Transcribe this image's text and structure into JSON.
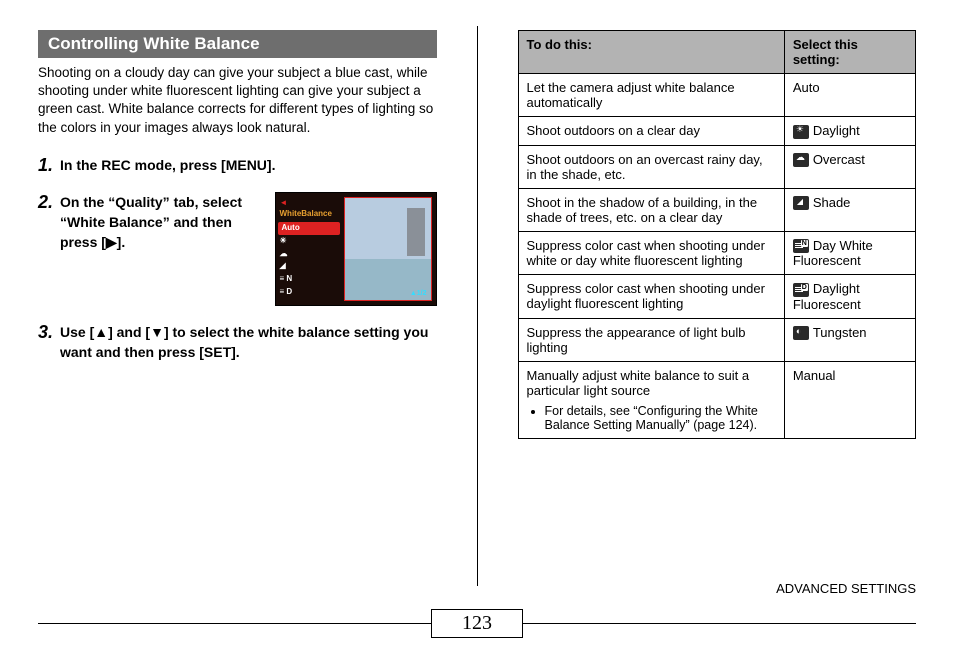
{
  "section_title": "Controlling White Balance",
  "intro": "Shooting on a cloudy day can give your subject a blue cast, while shooting under white fluorescent lighting can give your subject a green cast. White balance corrects for different types of lighting so the colors in your images always look natural.",
  "steps": {
    "s1": {
      "num": "1.",
      "text": "In the REC mode, press [MENU]."
    },
    "s2": {
      "num": "2.",
      "text": "On the “Quality” tab, select “White Balance” and then press [▶]."
    },
    "s3": {
      "num": "3.",
      "text": "Use [▲] and [▼] to select the white balance setting you want and then press [SET]."
    }
  },
  "lcd": {
    "title": "WhiteBalance",
    "selected": "Auto",
    "items_n": "N",
    "items_d": "D",
    "page": "▲1/2"
  },
  "table": {
    "header_left": "To do this:",
    "header_right": "Select this setting:",
    "rows": {
      "r0": {
        "desc": "Let the camera adjust white balance automatically",
        "setting": "Auto"
      },
      "r1": {
        "desc": "Shoot outdoors on a clear day",
        "setting": "Daylight"
      },
      "r2": {
        "desc": "Shoot outdoors on an overcast rainy day, in the shade, etc.",
        "setting": "Overcast"
      },
      "r3": {
        "desc": "Shoot in the shadow of a building, in the shade of trees, etc. on a clear day",
        "setting": "Shade"
      },
      "r4": {
        "desc": "Suppress color cast when shooting under white or day white fluorescent lighting",
        "setting": "Day White Fluorescent",
        "tag": "N"
      },
      "r5": {
        "desc": "Suppress color cast when shooting under daylight fluorescent lighting",
        "setting": "Daylight Fluorescent",
        "tag": "D"
      },
      "r6": {
        "desc": "Suppress the appearance of light bulb lighting",
        "setting": "Tungsten"
      },
      "r7": {
        "desc": "Manually adjust white balance to suit a particular light source",
        "bullet": "For details, see “Configuring the White Balance Setting Manually” (page 124).",
        "setting": "Manual"
      }
    }
  },
  "footer": {
    "page_number": "123",
    "label": "ADVANCED SETTINGS"
  }
}
